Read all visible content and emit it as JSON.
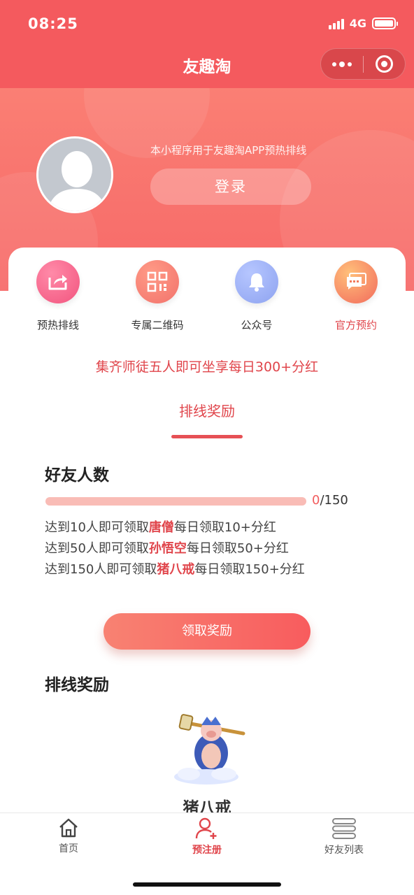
{
  "status_bar": {
    "time": "08:25",
    "network": "4G"
  },
  "nav": {
    "title": "友趣淘"
  },
  "hero": {
    "note": "本小程序用于友趣淘APP预热排线",
    "login_label": "登录"
  },
  "shortcuts": [
    {
      "label": "预热排线",
      "icon": "share-icon",
      "color": "#f2557f",
      "label_color": "#333333"
    },
    {
      "label": "专属二维码",
      "icon": "qrcode-icon",
      "color": "#f2736c",
      "label_color": "#333333"
    },
    {
      "label": "公众号",
      "icon": "bell-icon",
      "color": "#8ea3f0",
      "label_color": "#333333"
    },
    {
      "label": "官方预约",
      "icon": "chat-icon",
      "color": "#f6945a",
      "label_color": "#e0454b"
    }
  ],
  "promo_text": "集齐师徒五人即可坐享每日300+分红",
  "tab_title": "排线奖励",
  "friends": {
    "heading": "好友人数",
    "current": "0",
    "total": "/150",
    "progress": 0
  },
  "rules": [
    {
      "pre": "达到10人即可领取",
      "hl": "唐僧",
      "post": "每日领取10+分红"
    },
    {
      "pre": "达到50人即可领取",
      "hl": "孙悟空",
      "post": "每日领取50+分红"
    },
    {
      "pre": "达到150人即可领取",
      "hl": "猪八戒",
      "post": "每日领取150+分红"
    }
  ],
  "claim_label": "领取奖励",
  "reward_section": {
    "heading": "排线奖励",
    "character_name": "猪八戒"
  },
  "tabbar": [
    {
      "label": "首页",
      "icon": "home-icon",
      "active": false
    },
    {
      "label": "预注册",
      "icon": "user-add-icon",
      "active": true
    },
    {
      "label": "好友列表",
      "icon": "list-icon",
      "active": false
    }
  ],
  "colors": {
    "brand": "#f45a5e",
    "accent": "#e0454b"
  }
}
